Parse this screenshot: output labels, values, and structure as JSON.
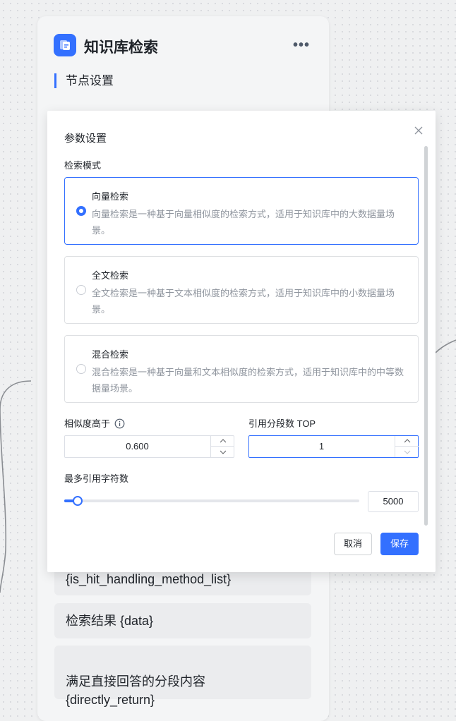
{
  "node": {
    "title": "知识库检索",
    "more_icon": "more-icon",
    "section_title": "节点设置",
    "variables": [
      "{is_hit_handling_method_list}",
      "检索结果 {data}",
      "满足直接回答的分段内容\n{directly_return}"
    ]
  },
  "dialog": {
    "title": "参数设置",
    "close_icon": "close-icon",
    "mode_label": "检索模式",
    "modes": [
      {
        "title": "向量检索",
        "desc": "向量检索是一种基于向量相似度的检索方式，适用于知识库中的大数据量场景。",
        "selected": true
      },
      {
        "title": "全文检索",
        "desc": "全文检索是一种基于文本相似度的检索方式，适用于知识库中的小数据量场景。",
        "selected": false
      },
      {
        "title": "混合检索",
        "desc": "混合检索是一种基于向量和文本相似度的检索方式，适用于知识库中的中等数据量场景。",
        "selected": false
      }
    ],
    "similarity_label": "相似度高于",
    "similarity_value": "0.600",
    "top_label": "引用分段数 TOP",
    "top_value": "1",
    "max_chars_label": "最多引用字符数",
    "max_chars_value": "5000",
    "max_chars_fraction": 0.046,
    "cancel_label": "取消",
    "save_label": "保存"
  },
  "colors": {
    "accent": "#3370ff",
    "muted_text": "#8f959e",
    "border": "#dee0e3"
  }
}
